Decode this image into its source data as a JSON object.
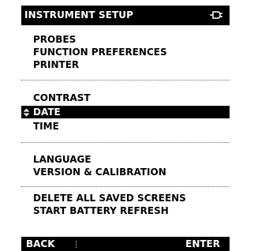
{
  "screen": {
    "title": "INSTRUMENT SETUP",
    "status_icon": "power-plug-icon",
    "menu_groups": [
      {
        "items": [
          "PROBES",
          "FUNCTION PREFERENCES",
          "PRINTER"
        ]
      },
      {
        "items": [
          "CONTRAST",
          "DATE",
          "TIME"
        ],
        "selected": "DATE"
      },
      {
        "items": [
          "LANGUAGE",
          "VERSION & CALIBRATION"
        ]
      },
      {
        "items": [
          "DELETE ALL SAVED SCREENS",
          "START BATTERY REFRESH"
        ]
      }
    ],
    "soft_keys": {
      "back": "BACK",
      "enter": "ENTER"
    },
    "colors": {
      "background": "#ffffff",
      "foreground": "#000000",
      "selection": "#000000",
      "selection_text": "#ffffff"
    }
  }
}
